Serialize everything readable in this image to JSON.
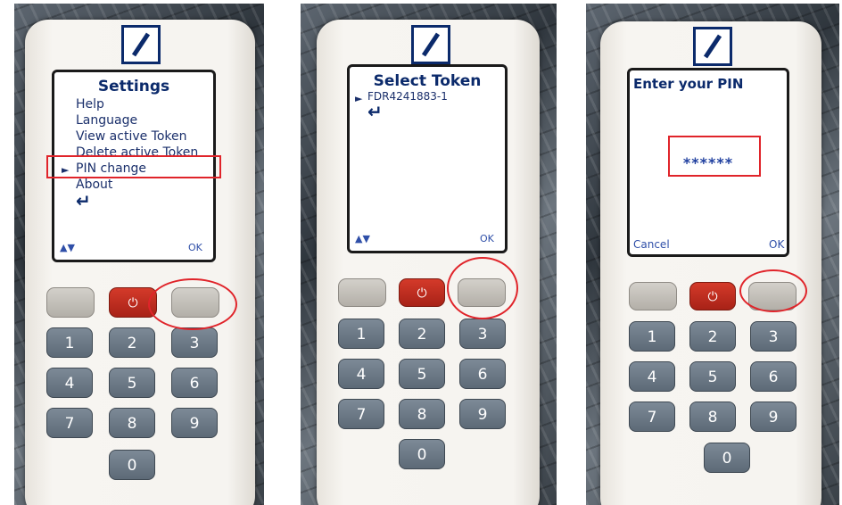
{
  "colors": {
    "brand_blue": "#0b2a6b",
    "annotation_red": "#e0242a",
    "power_red": "#c02b1f",
    "key_grey": "#6b7783"
  },
  "icons": {
    "power": "power-icon",
    "enter": "return-arrow-icon",
    "selector": "triangle-right-icon",
    "nav": "up-down-arrows-icon",
    "logo": "slash-box-logo"
  },
  "screens": {
    "settings": {
      "title": "Settings",
      "items": [
        "Help",
        "Language",
        "View active Token",
        "Delete active Token",
        "PIN change",
        "About"
      ],
      "selected_marker": "►",
      "enter_symbol": "↵",
      "nav_label": "▲▼",
      "ok_label": "OK"
    },
    "select_token": {
      "title": "Select Token",
      "marker": "►",
      "token": "FDR4241883-1",
      "enter_symbol": "↵",
      "nav_label": "▲▼",
      "ok_label": "OK"
    },
    "enter_pin": {
      "title": "Enter your PIN",
      "pin_mask": "******",
      "cancel_label": "Cancel",
      "ok_label": "OK"
    }
  },
  "buttons": {
    "power_symbol": "⏻"
  },
  "keypad": [
    "1",
    "2",
    "3",
    "4",
    "5",
    "6",
    "7",
    "8",
    "9",
    "0"
  ]
}
